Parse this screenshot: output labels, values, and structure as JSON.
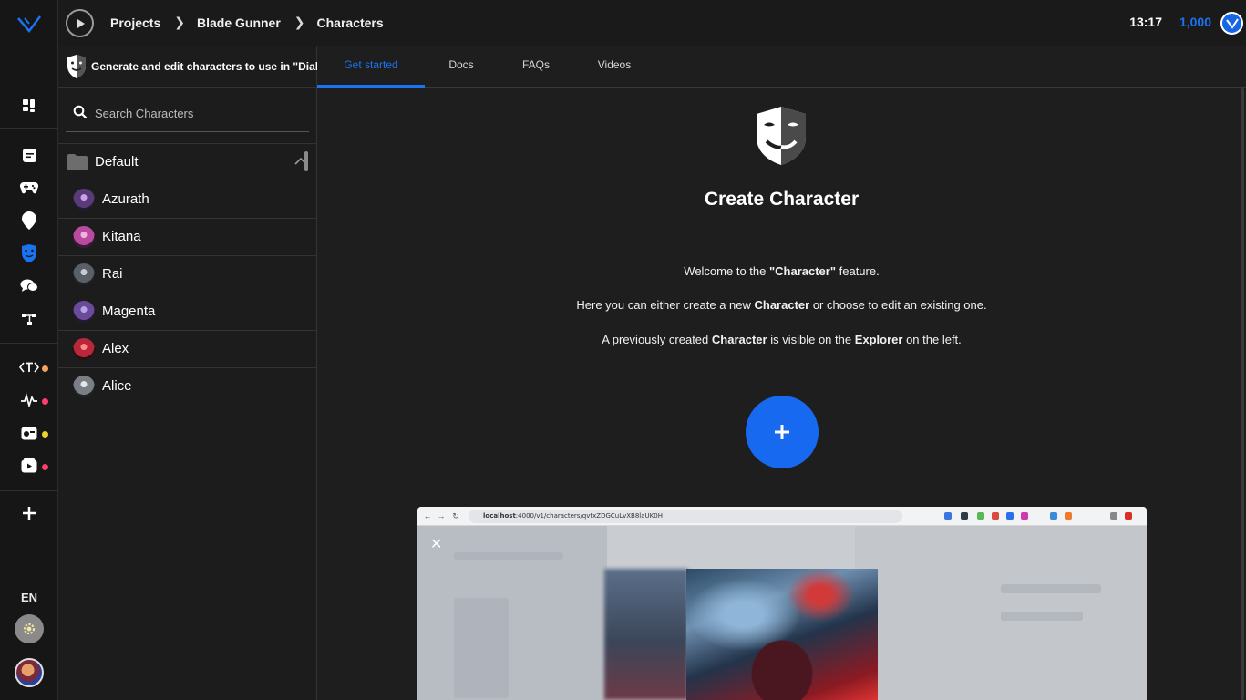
{
  "rail": {
    "lang": "EN",
    "dots": [
      "#f5a25c",
      "#ff3d6e",
      "#f2d22a",
      "#ff3d6e"
    ],
    "icons": [
      "logo-icon",
      "dashboard-icon",
      "notes-icon",
      "gamepad-icon",
      "location-pin-icon",
      "character-mask-icon",
      "dialog-bubbles-icon",
      "flow-nodes-icon",
      "text-tags-icon",
      "waveform-icon",
      "media-editor-icon",
      "video-play-icon",
      "add-icon",
      "settings-gear-icon",
      "user-avatar"
    ]
  },
  "topbar": {
    "breadcrumbs": [
      "Projects",
      "Blade Gunner",
      "Characters"
    ],
    "time": "13:17",
    "credits": "1,000"
  },
  "explorer": {
    "description": "Generate and edit characters to use in \"Dialog",
    "search_placeholder": "Search Characters",
    "folder": "Default",
    "characters": [
      {
        "name": "Azurath",
        "color": "#5b3a7a"
      },
      {
        "name": "Kitana",
        "color": "#b84aa0"
      },
      {
        "name": "Rai",
        "color": "#5a6068"
      },
      {
        "name": "Magenta",
        "color": "#6a4a9a"
      },
      {
        "name": "Alex",
        "color": "#b8283a"
      },
      {
        "name": "Alice",
        "color": "#7a7f86"
      }
    ]
  },
  "main": {
    "tabs": [
      "Get started",
      "Docs",
      "FAQs",
      "Videos"
    ],
    "active_tab": "Get started",
    "title": "Create Character",
    "line1": {
      "a": "Welcome to the ",
      "b": "\"Character\"",
      "c": " feature."
    },
    "line2": {
      "a": "Here you can either create a new ",
      "b": "Character",
      "c": " or choose to edit an existing one."
    },
    "line3": {
      "a": "A previously created ",
      "b": "Character",
      "c": " is visible on the ",
      "d": "Explorer",
      "e": " on the left."
    },
    "accent": "#1769ef"
  },
  "screenshot": {
    "url_host": "localhost",
    "url_rest": ":4000/v1/characters/qvtxZDGCuLvXB8laUK0H"
  }
}
